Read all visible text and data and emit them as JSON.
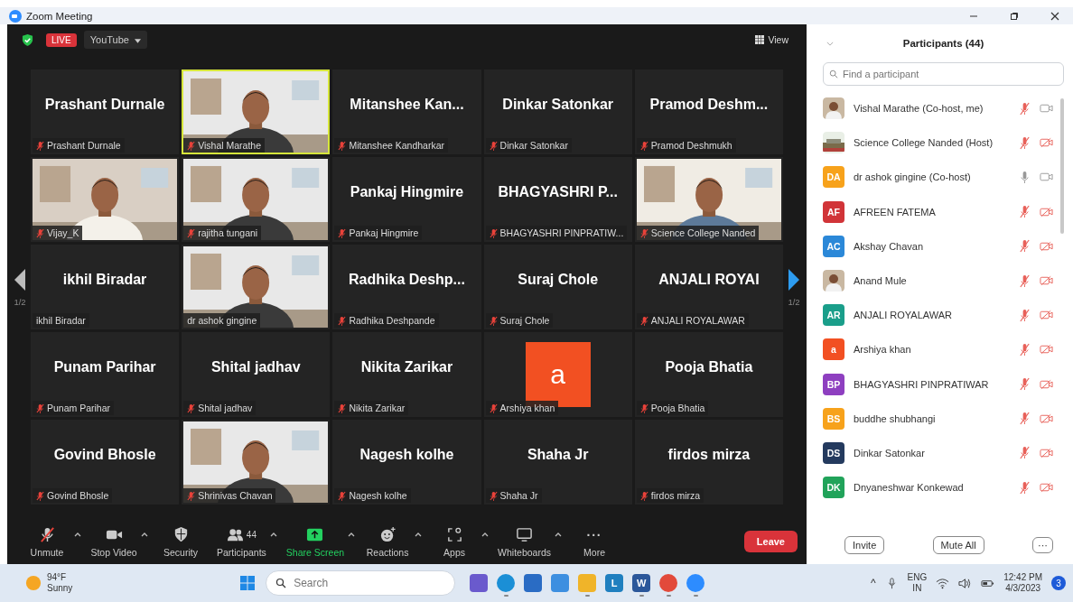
{
  "window": {
    "title": "Zoom Meeting"
  },
  "meeting_bar": {
    "live": "LIVE",
    "stream": "YouTube",
    "view": "View"
  },
  "pager": {
    "left": "1/2",
    "right": "1/2"
  },
  "tiles": [
    {
      "kind": "name",
      "title": "Prashant Durnale",
      "label": "Prashant Durnale",
      "muted": true,
      "active": false
    },
    {
      "kind": "video",
      "label": "Vishal Marathe",
      "muted": true,
      "active": true
    },
    {
      "kind": "name",
      "title": "Mitanshee Kan...",
      "label": "Mitanshee Kandharkar",
      "muted": true,
      "active": false
    },
    {
      "kind": "name",
      "title": "Dinkar Satonkar",
      "label": "Dinkar Satonkar",
      "muted": true,
      "active": false
    },
    {
      "kind": "name",
      "title": "Pramod Deshm...",
      "label": "Pramod Deshmukh",
      "muted": true,
      "active": false
    },
    {
      "kind": "video",
      "label": "Vijay_K",
      "muted": true,
      "active": false
    },
    {
      "kind": "video",
      "label": "rajitha tungani",
      "muted": true,
      "active": false
    },
    {
      "kind": "name",
      "title": "Pankaj Hingmire",
      "label": "Pankaj Hingmire",
      "muted": true,
      "active": false
    },
    {
      "kind": "name",
      "title": "BHAGYASHRI P...",
      "label": "BHAGYASHRI PINPRATIW...",
      "muted": true,
      "active": false
    },
    {
      "kind": "video",
      "label": "Science College Nanded",
      "muted": true,
      "active": false
    },
    {
      "kind": "name",
      "title": "ikhil Biradar",
      "label": "ikhil Biradar",
      "muted": false,
      "active": false
    },
    {
      "kind": "video",
      "label": "dr ashok gingine",
      "muted": false,
      "active": false
    },
    {
      "kind": "name",
      "title": "Radhika Deshp...",
      "label": "Radhika Deshpande",
      "muted": true,
      "active": false
    },
    {
      "kind": "name",
      "title": "Suraj Chole",
      "label": "Suraj Chole",
      "muted": true,
      "active": false
    },
    {
      "kind": "name",
      "title": "ANJALI ROYAI",
      "label": "ANJALI ROYALAWAR",
      "muted": true,
      "active": false
    },
    {
      "kind": "name",
      "title": "Punam Parihar",
      "label": "Punam Parihar",
      "muted": true,
      "active": false
    },
    {
      "kind": "name",
      "title": "Shital jadhav",
      "label": "Shital jadhav",
      "muted": true,
      "active": false
    },
    {
      "kind": "name",
      "title": "Nikita Zarikar",
      "label": "Nikita Zarikar",
      "muted": true,
      "active": false
    },
    {
      "kind": "avatar",
      "letter": "a",
      "color": "#f25022",
      "label": "Arshiya khan",
      "muted": true,
      "active": false
    },
    {
      "kind": "name",
      "title": "Pooja Bhatia",
      "label": "Pooja Bhatia",
      "muted": true,
      "active": false
    },
    {
      "kind": "name",
      "title": "Govind Bhosle",
      "label": "Govind Bhosle",
      "muted": true,
      "active": false
    },
    {
      "kind": "video",
      "label": "Shrinivas Chavan",
      "muted": true,
      "active": false
    },
    {
      "kind": "name",
      "title": "Nagesh kolhe",
      "label": "Nagesh kolhe",
      "muted": true,
      "active": false
    },
    {
      "kind": "name",
      "title": "Shaha Jr",
      "label": "Shaha Jr",
      "muted": true,
      "active": false
    },
    {
      "kind": "name",
      "title": "firdos mirza",
      "label": "firdos mirza",
      "muted": true,
      "active": false
    }
  ],
  "toolbar": [
    {
      "kind": "mic",
      "label": "Unmute",
      "muted": true,
      "caret": true,
      "highlighted": false
    },
    {
      "kind": "camera",
      "label": "Stop Video",
      "caret": true,
      "highlighted": false
    },
    {
      "kind": "security",
      "label": "Security",
      "caret": false,
      "highlighted": false
    },
    {
      "kind": "participants",
      "label": "Participants",
      "count": "44",
      "caret": true,
      "highlighted": false
    },
    {
      "kind": "share",
      "label": "Share Screen",
      "caret": true,
      "highlighted": true
    },
    {
      "kind": "reactions",
      "label": "Reactions",
      "caret": true,
      "highlighted": false
    },
    {
      "kind": "apps",
      "label": "Apps",
      "caret": true,
      "highlighted": false
    },
    {
      "kind": "whiteboard",
      "label": "Whiteboards",
      "caret": true,
      "highlighted": false
    },
    {
      "kind": "more",
      "label": "More",
      "glyph": "···",
      "caret": false,
      "highlighted": false
    }
  ],
  "leave": "Leave",
  "participants_panel": {
    "title": "Participants (44)",
    "search": {
      "placeholder": "Find a participant"
    },
    "items": [
      {
        "kind": "picture",
        "name": "Vishal Marathe (Co-host, me)",
        "muted": true,
        "video_on": true
      },
      {
        "kind": "picture",
        "name": "Science College Nanded (Host)",
        "muted": true,
        "video_on": false
      },
      {
        "kind": "initials",
        "initials": "DA",
        "color": "#f7a21b",
        "name": "dr ashok gingine (Co-host)",
        "muted": false,
        "video_on": true
      },
      {
        "kind": "initials",
        "initials": "AF",
        "color": "#d13438",
        "name": "AFREEN FATEMA",
        "muted": true,
        "video_on": false
      },
      {
        "kind": "initials",
        "initials": "AC",
        "color": "#2b88d8",
        "name": "Akshay Chavan",
        "muted": true,
        "video_on": false
      },
      {
        "kind": "picture",
        "name": "Anand Mule",
        "muted": true,
        "video_on": false
      },
      {
        "kind": "initials",
        "initials": "AR",
        "color": "#1a9e8a",
        "name": "ANJALI ROYALAWAR",
        "muted": true,
        "video_on": false
      },
      {
        "kind": "initials",
        "initials": "a",
        "color": "#f25022",
        "name": "Arshiya khan",
        "muted": true,
        "video_on": false
      },
      {
        "kind": "initials",
        "initials": "BP",
        "color": "#8e3fc0",
        "name": "BHAGYASHRI PINPRATIWAR",
        "muted": true,
        "video_on": false
      },
      {
        "kind": "initials",
        "initials": "BS",
        "color": "#f7a21b",
        "name": "buddhe shubhangi",
        "muted": true,
        "video_on": false
      },
      {
        "kind": "initials",
        "initials": "DS",
        "color": "#243a5e",
        "name": "Dinkar Satonkar",
        "muted": true,
        "video_on": false
      },
      {
        "kind": "initials",
        "initials": "DK",
        "color": "#21a35a",
        "name": "Dnyaneshwar Konkewad",
        "muted": true,
        "video_on": false
      }
    ],
    "buttons": [
      "Invite",
      "Mute All"
    ],
    "more": "···"
  },
  "taskbar": {
    "temperature": "94°F",
    "weather": "Sunny",
    "search": {
      "placeholder": "Search"
    },
    "apps": [
      {
        "kind": "chat",
        "open": false
      },
      {
        "kind": "edge",
        "open": true
      },
      {
        "kind": "store",
        "open": false
      },
      {
        "kind": "mail",
        "open": false
      },
      {
        "kind": "files",
        "open": true
      },
      {
        "kind": "letter",
        "glyph": "L",
        "open": false
      },
      {
        "kind": "word",
        "glyph": "W",
        "open": true
      },
      {
        "kind": "chrome",
        "open": true
      },
      {
        "kind": "zoom",
        "open": true
      }
    ],
    "tray_caret": "^",
    "language": "ENG",
    "region": "IN",
    "time": "12:42 PM",
    "date": "4/3/2023",
    "notifications": "3"
  }
}
